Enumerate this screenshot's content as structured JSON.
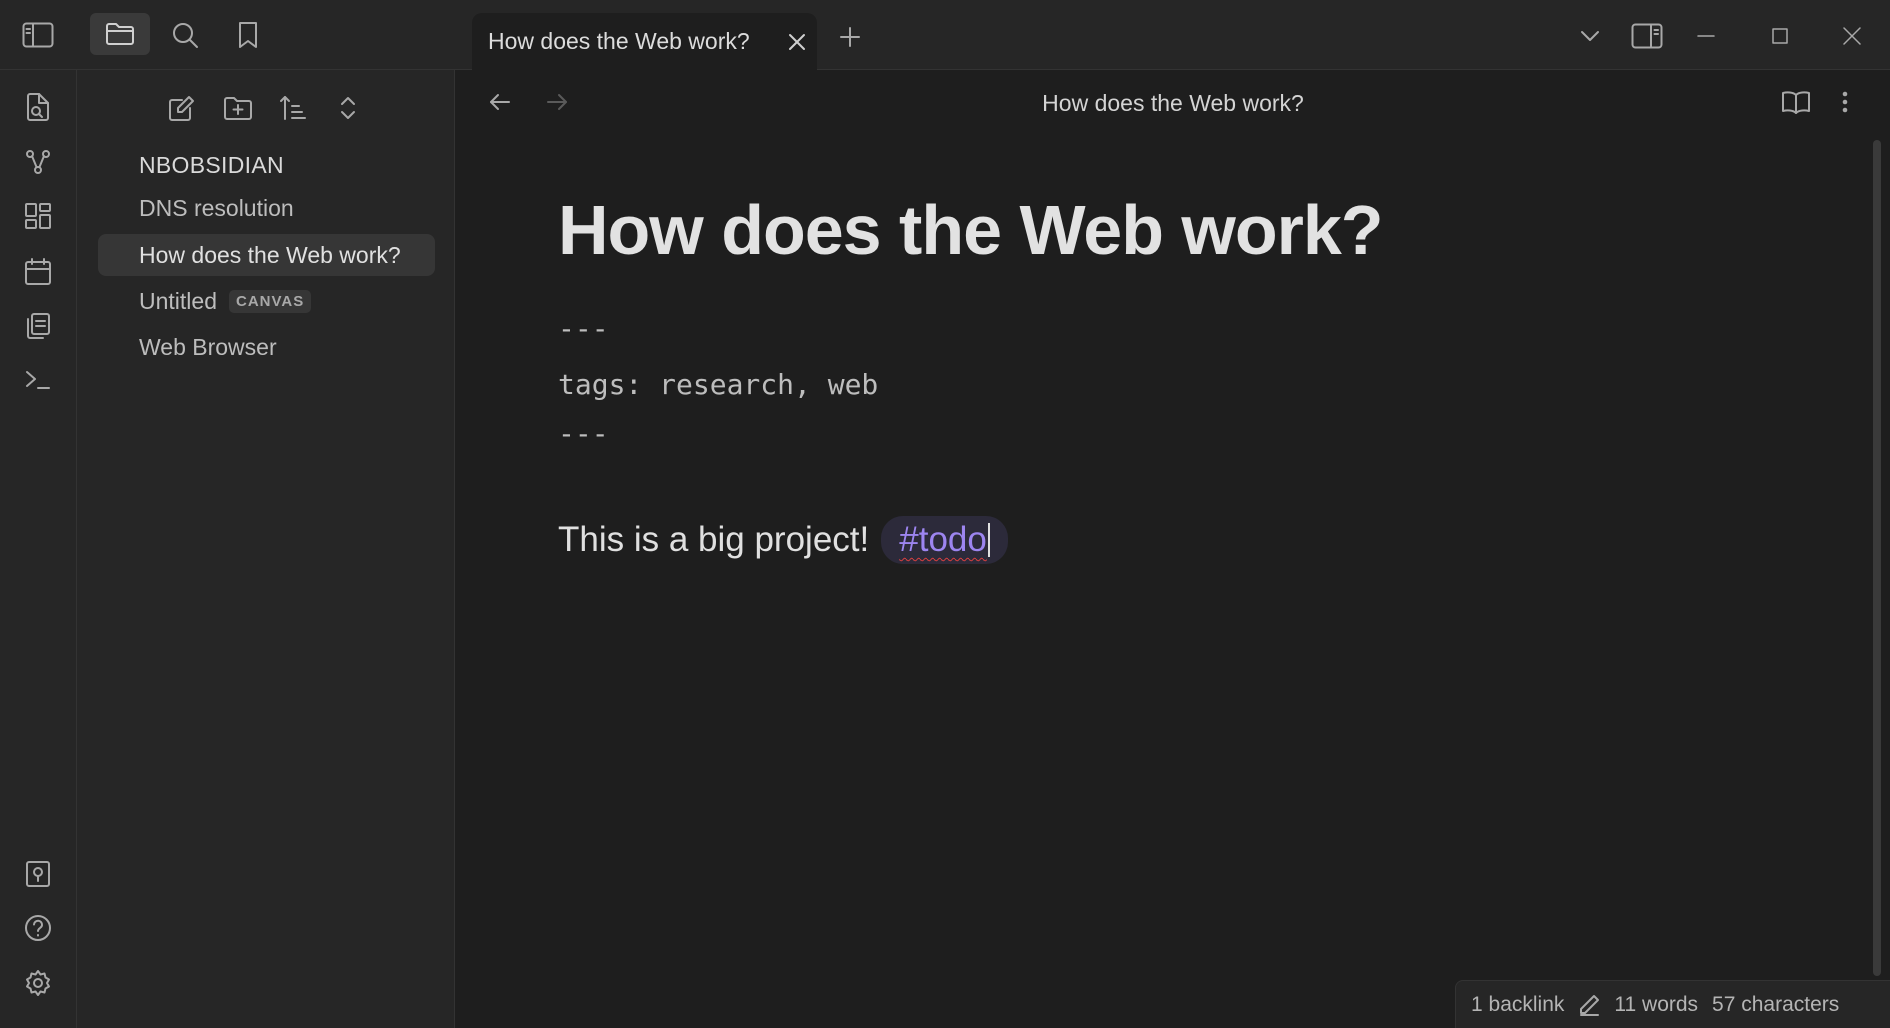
{
  "window": {
    "tab_title": "How does the Web work?",
    "icons": [
      "sidebar-toggle-icon",
      "folder-icon",
      "search-icon",
      "bookmark-icon",
      "close-icon",
      "plus-icon",
      "chevron-down-icon",
      "split-pane-icon",
      "minimize-icon",
      "maximize-icon",
      "window-close-icon"
    ]
  },
  "ribbon": {
    "top_icons": [
      "open-quick-switcher-icon",
      "graph-view-icon",
      "canvas-icon",
      "daily-note-icon",
      "templates-icon",
      "command-palette-icon"
    ],
    "bottom_icons": [
      "vault-switch-icon",
      "help-icon",
      "settings-icon"
    ]
  },
  "sidebar": {
    "tools": [
      "new-note-icon",
      "new-folder-icon",
      "sort-icon",
      "collapse-icon"
    ],
    "vault_name": "NBOBSIDIAN",
    "files": [
      {
        "label": "DNS resolution",
        "badge": ""
      },
      {
        "label": "How does the Web work?",
        "badge": ""
      },
      {
        "label": "Untitled",
        "badge": "CANVAS"
      },
      {
        "label": "Web Browser",
        "badge": ""
      }
    ]
  },
  "editor": {
    "view_title": "How does the Web work?",
    "heading": "How does the Web work?",
    "frontmatter_open": "---",
    "frontmatter_line": "tags: research, web",
    "frontmatter_close": "---",
    "paragraph": "This is a big project!",
    "tag": "#todo",
    "icons": [
      "back-arrow-icon",
      "forward-arrow-icon",
      "reading-view-icon",
      "more-options-icon"
    ]
  },
  "status": {
    "backlinks": "1 backlink",
    "words": "11 words",
    "characters": "57 characters"
  },
  "colors": {
    "background": "#1e1e1e",
    "panel": "#262626",
    "accent": "#9d85f0",
    "tag_bg": "#2c2a3a"
  }
}
